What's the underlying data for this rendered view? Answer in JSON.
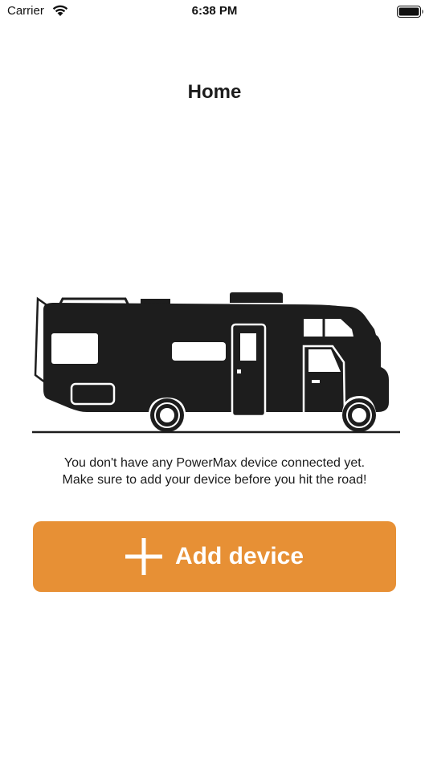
{
  "status_bar": {
    "carrier": "Carrier",
    "time": "6:38 PM",
    "wifi_icon": "wifi-icon",
    "battery_icon": "battery-full-icon"
  },
  "header": {
    "title": "Home"
  },
  "empty_state": {
    "illustration": "rv-motorhome-illustration",
    "message_line1": "You don't have any PowerMax device connected yet.",
    "message_line2": "Make sure to add your device before you hit the road!"
  },
  "add_device_button": {
    "icon": "plus-icon",
    "label": "Add device",
    "color": "#e79035"
  }
}
